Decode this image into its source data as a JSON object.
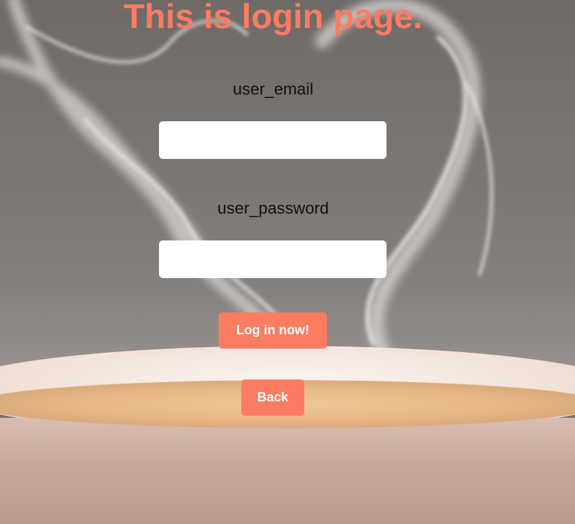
{
  "page": {
    "title": "This is login page."
  },
  "form": {
    "email_label": "user_email",
    "email_value": "",
    "password_label": "user_password",
    "password_value": "",
    "login_button_label": "Log in now!",
    "back_button_label": "Back"
  },
  "colors": {
    "accent": "#fc7c62",
    "input_background": "#ffffff",
    "label_text": "#111111"
  }
}
